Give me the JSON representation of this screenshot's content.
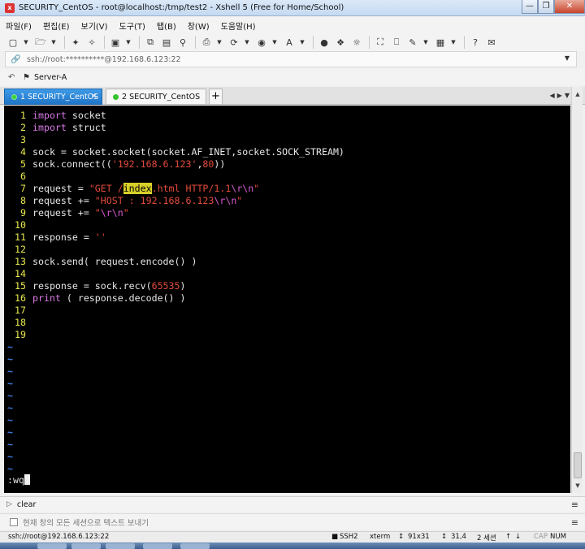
{
  "window": {
    "title": "SECURITY_CentOS - root@localhost:/tmp/test2 - Xshell 5 (Free for Home/School)",
    "controls": [
      "minimize",
      "restore",
      "close"
    ]
  },
  "menu": [
    "파일(F)",
    "편집(E)",
    "보기(V)",
    "도구(T)",
    "탭(B)",
    "창(W)",
    "도움말(H)"
  ],
  "toolbar_icons": [
    "new-session-icon",
    "open-folder-icon",
    "reconnect-icon",
    "disconnect-icon",
    "properties-icon",
    "copy-icon",
    "paste-icon",
    "find-icon",
    "print-icon",
    "transfer-icon",
    "globe-icon",
    "font-icon",
    "lock-icon",
    "script-icon",
    "fullscreen-icon",
    "lock-screen-icon",
    "compose-icon",
    "layout-icon",
    "help-icon",
    "chat-icon"
  ],
  "address": {
    "value": "ssh://root:**********@192.168.6.123:22"
  },
  "links": {
    "item": "Server-A"
  },
  "tabs": [
    {
      "label": "1 SECURITY_CentOS",
      "active": true
    },
    {
      "label": "2 SECURITY_CentOS",
      "active": false
    }
  ],
  "add_tab": "+",
  "editor": {
    "lines": [
      {
        "n": "1",
        "parts": [
          [
            "kw",
            "import"
          ],
          [
            "",
            " socket"
          ]
        ]
      },
      {
        "n": "2",
        "parts": [
          [
            "kw",
            "import"
          ],
          [
            "",
            " struct"
          ]
        ]
      },
      {
        "n": "3",
        "parts": []
      },
      {
        "n": "4",
        "parts": [
          [
            "",
            "sock = socket.socket(socket.AF_INET,socket.SOCK_STREAM)"
          ]
        ]
      },
      {
        "n": "5",
        "parts": [
          [
            "",
            "sock.connect(("
          ],
          [
            "str",
            "'192.168.6.123'"
          ],
          [
            "",
            ","
          ],
          [
            "num",
            "80"
          ],
          [
            "",
            "))"
          ]
        ]
      },
      {
        "n": "6",
        "parts": []
      },
      {
        "n": "7",
        "parts": [
          [
            "",
            "request = "
          ],
          [
            "str",
            "\"GET /"
          ],
          [
            "hl",
            "index"
          ],
          [
            "str",
            ".html HTTP/1.1"
          ],
          [
            "esc",
            "\\r\\n"
          ],
          [
            "str",
            "\""
          ]
        ]
      },
      {
        "n": "8",
        "parts": [
          [
            "",
            "request += "
          ],
          [
            "str",
            "\"HOST : 192.168.6.123"
          ],
          [
            "esc",
            "\\r\\n"
          ],
          [
            "str",
            "\""
          ]
        ]
      },
      {
        "n": "9",
        "parts": [
          [
            "",
            "request += "
          ],
          [
            "str",
            "\""
          ],
          [
            "esc",
            "\\r\\n"
          ],
          [
            "str",
            "\""
          ]
        ]
      },
      {
        "n": "10",
        "parts": []
      },
      {
        "n": "11",
        "parts": [
          [
            "",
            "response = "
          ],
          [
            "str",
            "''"
          ]
        ]
      },
      {
        "n": "12",
        "parts": []
      },
      {
        "n": "13",
        "parts": [
          [
            "",
            "sock.send( request.encode() )"
          ]
        ]
      },
      {
        "n": "14",
        "parts": []
      },
      {
        "n": "15",
        "parts": [
          [
            "",
            "response = sock.recv("
          ],
          [
            "num",
            "65535"
          ],
          [
            "",
            ")"
          ]
        ]
      },
      {
        "n": "16",
        "parts": [
          [
            "kw",
            "print"
          ],
          [
            "",
            " ( response.decode() )"
          ]
        ]
      },
      {
        "n": "17",
        "parts": []
      },
      {
        "n": "18",
        "parts": []
      },
      {
        "n": "19",
        "parts": []
      }
    ],
    "tilde_count": 11,
    "tilde": "~",
    "command": ":wq"
  },
  "compose": {
    "label": "clear"
  },
  "send": {
    "placeholder": "현재 창의 모든 세션으로 텍스트 보내기"
  },
  "status": {
    "connection": "ssh://root@192.168.6.123:22",
    "protocol": "SSH2",
    "terminal": "xterm",
    "size": "91x31",
    "position": "31,4",
    "sessions": "2 세션",
    "cap": "CAP",
    "num": "NUM"
  },
  "colors": {
    "terminal_bg": "#000000",
    "line_number": "#e9e94f",
    "keyword": "#d979e6",
    "string": "#e34b3b",
    "tilde": "#3f7fe6",
    "active_tab": "#2a82d6"
  }
}
